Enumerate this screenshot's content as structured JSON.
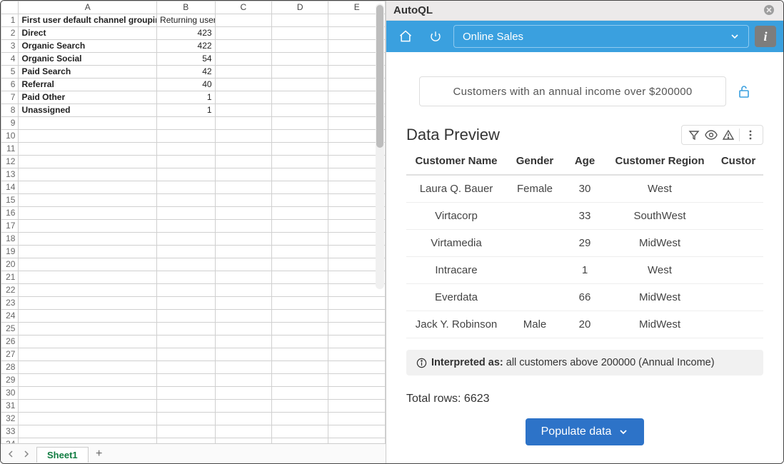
{
  "spreadsheet": {
    "columns": [
      "A",
      "B",
      "C",
      "D",
      "E"
    ],
    "row_count_visible": 35,
    "rows": [
      {
        "a": "First user default channel grouping",
        "b": "Returning users",
        "bold": true,
        "b_is_text": true
      },
      {
        "a": "Direct",
        "b": "423",
        "bold": true
      },
      {
        "a": "Organic Search",
        "b": "422",
        "bold": true
      },
      {
        "a": "Organic Social",
        "b": "54",
        "bold": true
      },
      {
        "a": "Paid Search",
        "b": "42",
        "bold": true
      },
      {
        "a": "Referral",
        "b": "40",
        "bold": true
      },
      {
        "a": "Paid Other",
        "b": "1",
        "bold": true
      },
      {
        "a": "Unassigned",
        "b": "1",
        "bold": true
      }
    ],
    "active_tab": "Sheet1"
  },
  "panel": {
    "title": "AutoQL",
    "datasource": "Online Sales",
    "query": "Customers with an annual income over $200000",
    "preview_title": "Data Preview",
    "columns": [
      "Customer Name",
      "Gender",
      "Age",
      "Customer Region",
      "Custor"
    ],
    "rows": [
      {
        "name": "Laura Q. Bauer",
        "gender": "Female",
        "age": "30",
        "region": "West"
      },
      {
        "name": "Virtacorp",
        "gender": "",
        "age": "33",
        "region": "SouthWest"
      },
      {
        "name": "Virtamedia",
        "gender": "",
        "age": "29",
        "region": "MidWest"
      },
      {
        "name": "Intracare",
        "gender": "",
        "age": "1",
        "region": "West"
      },
      {
        "name": "Everdata",
        "gender": "",
        "age": "66",
        "region": "MidWest"
      },
      {
        "name": "Jack Y. Robinson",
        "gender": "Male",
        "age": "20",
        "region": "MidWest"
      }
    ],
    "interpreted_label": "Interpreted as:",
    "interpreted_text": "all customers above 200000 (Annual Income)",
    "total_rows_label": "Total rows:",
    "total_rows": "6623",
    "populate_label": "Populate data"
  }
}
